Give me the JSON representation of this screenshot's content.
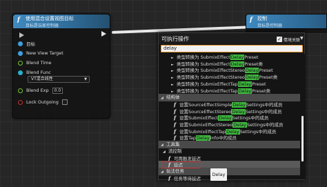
{
  "left_node": {
    "fx_glyph": "f",
    "title": "使用混合设置视图目标",
    "subtitle": "目标是玩家控制器",
    "pins": [
      {
        "label": "目标"
      },
      {
        "label": "New View Target"
      },
      {
        "label": "Blend Time"
      },
      {
        "label": "Blend Func"
      },
      {
        "label": "Blend Exp"
      },
      {
        "label": "Lock Outgoing"
      }
    ],
    "blend_func_value": "VT混合线性",
    "blend_func_arrow": "▼",
    "blend_exp_value": "0.0"
  },
  "right_node": {
    "fx_glyph": "f",
    "title": "控制",
    "subtitle": "目标是控制器"
  },
  "menu": {
    "title": "可执行操作",
    "context_check": "✓",
    "context_label": "情境关联",
    "context_arrow": "▼",
    "search_value": "delay",
    "rows": [
      {
        "kind": "fx",
        "pre": "类型转换为 SubmixEffect",
        "hl": "Delay",
        "post": "Preset"
      },
      {
        "kind": "fx",
        "pre": "类型转换为 SubmixEffect",
        "hl": "Delay",
        "post": "Preset类"
      },
      {
        "kind": "fx",
        "pre": "类型转换为 SubmixEffectStereo",
        "hl": "Delay",
        "post": "Preset"
      },
      {
        "kind": "fx",
        "pre": "类型转换为 SubmixEffectStereo",
        "hl": "Delay",
        "post": "Preset类"
      },
      {
        "kind": "fx",
        "pre": "类型转换为 SubmixEffectTap",
        "hl": "Delay",
        "post": "Preset"
      },
      {
        "kind": "fx",
        "pre": "类型转换为 SubmixEffectTap",
        "hl": "Delay",
        "post": "Preset类"
      },
      {
        "kind": "cat",
        "label": "结构体"
      },
      {
        "kind": "fx2",
        "pre": "设置SourceEffectSimple",
        "hl": "Delay",
        "post": "Settings中的成员"
      },
      {
        "kind": "fx2",
        "pre": "设置SourceEffectStereo",
        "hl": "Delay",
        "post": "Settings中的成员"
      },
      {
        "kind": "fx2",
        "pre": "设置SubmixEffect",
        "hl": "Delay",
        "post": "Settings中的成员"
      },
      {
        "kind": "fx2",
        "pre": "设置SubmixEffectStereo",
        "hl": "Delay",
        "post": "Settings中的成员"
      },
      {
        "kind": "fx2",
        "pre": "设置SubmixEffectTap",
        "hl": "Delay",
        "post": "Settings中的成员"
      },
      {
        "kind": "fx2",
        "pre": "设置Tap",
        "hl": "Delay",
        "post": "Info中的成员"
      },
      {
        "kind": "cat",
        "label": "工具集"
      },
      {
        "kind": "cat2",
        "label": "流控制"
      },
      {
        "kind": "fx3",
        "label": "可再触发延迟"
      },
      {
        "kind": "fx3sel",
        "label": "延迟"
      },
      {
        "kind": "cat",
        "label": "玩法任务"
      },
      {
        "kind": "fx3",
        "label": "任务等待延迟"
      }
    ]
  },
  "tooltip": {
    "text": "Delay"
  },
  "colors": {
    "header_blue": "#3f8ac0",
    "highlight_green": "#3fb83f",
    "search_border": "#d88a20",
    "selection_red": "#c83030"
  }
}
